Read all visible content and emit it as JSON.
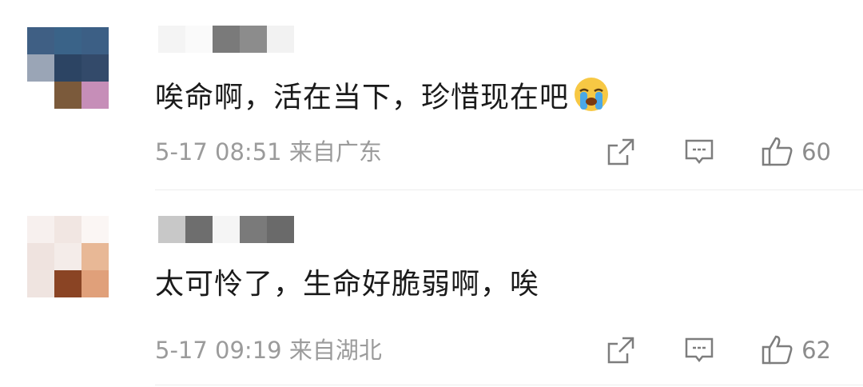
{
  "comments": [
    {
      "text": "唉命啊，活在当下，珍惜现在吧",
      "emoji": "loudly-crying-face",
      "meta": "5-17 08:51 来自广东",
      "likes": "60",
      "avatar_colors": [
        "#3f5f84",
        "#3a6388",
        "#3c5f85",
        "#9aa5b6",
        "#2c4463",
        "#334a6a",
        "#ffffff",
        "#7b5a3b",
        "#c68eb8"
      ]
    },
    {
      "text": "太可怜了，生命好脆弱啊，唉",
      "meta": "5-17 09:19 来自湖北",
      "likes": "62",
      "avatar_colors": [
        "#f7f0ee",
        "#f1e6e2",
        "#fbf6f4",
        "#efe3df",
        "#f4ece9",
        "#e8b896",
        "#efe4e0",
        "#8a4424",
        "#e0a07a"
      ]
    }
  ]
}
